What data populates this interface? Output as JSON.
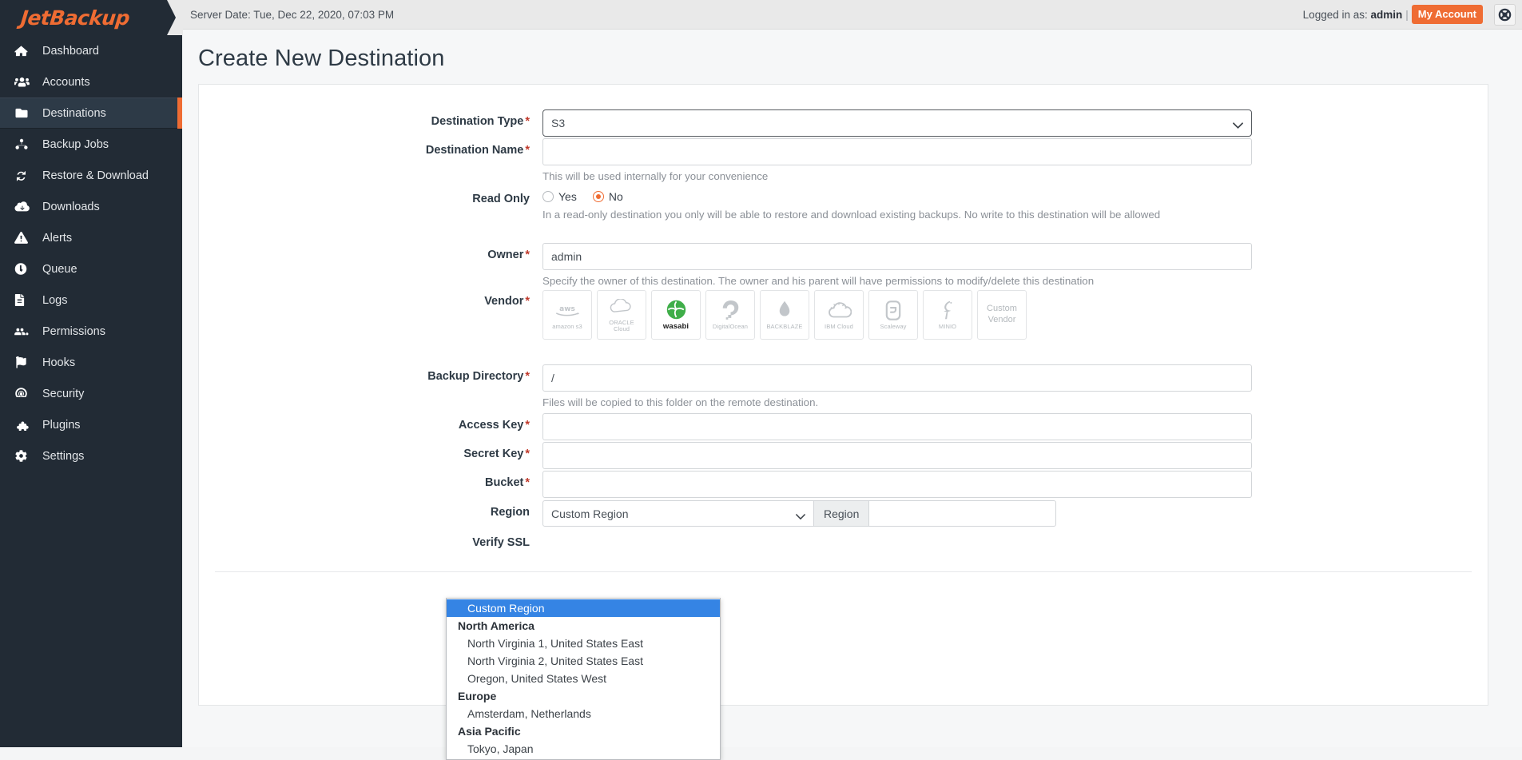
{
  "brand": {
    "name_main": "JetBack",
    "name_accent": "up",
    "full": "JetBackup"
  },
  "topbar": {
    "server_date": "Server Date: Tue, Dec 22, 2020, 07:03 PM",
    "logged_in_prefix": "Logged in as:",
    "logged_in_user": "admin",
    "separator": "|",
    "my_account_label": "My Account",
    "support_icon": "lifebuoy-icon"
  },
  "sidebar": {
    "items": [
      {
        "label": "Dashboard",
        "icon": "home-icon",
        "active": false
      },
      {
        "label": "Accounts",
        "icon": "users-icon",
        "active": false
      },
      {
        "label": "Destinations",
        "icon": "folder-icon",
        "active": true
      },
      {
        "label": "Backup Jobs",
        "icon": "sitemap-icon",
        "active": false
      },
      {
        "label": "Restore & Download",
        "icon": "sync-icon",
        "active": false
      },
      {
        "label": "Downloads",
        "icon": "cloud-download-icon",
        "active": false
      },
      {
        "label": "Alerts",
        "icon": "warning-icon",
        "active": false
      },
      {
        "label": "Queue",
        "icon": "clock-icon",
        "active": false
      },
      {
        "label": "Logs",
        "icon": "file-text-icon",
        "active": false
      },
      {
        "label": "Permissions",
        "icon": "users-cog-icon",
        "active": false
      },
      {
        "label": "Hooks",
        "icon": "flag-icon",
        "active": false
      },
      {
        "label": "Security",
        "icon": "fingerprint-icon",
        "active": false
      },
      {
        "label": "Plugins",
        "icon": "puzzle-icon",
        "active": false
      },
      {
        "label": "Settings",
        "icon": "gear-icon",
        "active": false
      }
    ]
  },
  "page": {
    "title": "Create New Destination"
  },
  "form": {
    "destination_type": {
      "label": "Destination Type",
      "required": "*",
      "value": "S3",
      "options": [
        "S3"
      ]
    },
    "destination_name": {
      "label": "Destination Name",
      "required": "*",
      "value": "",
      "placeholder": "",
      "help": "This will be used internally for your convenience"
    },
    "read_only": {
      "label": "Read Only",
      "options": [
        {
          "label": "Yes",
          "selected": false
        },
        {
          "label": "No",
          "selected": true
        }
      ],
      "help": "In a read-only destination you only will be able to restore and download existing backups. No write to this destination will be allowed"
    },
    "owner": {
      "label": "Owner",
      "required": "*",
      "value": "admin",
      "help": "Specify the owner of this destination. The owner and his parent will have permissions to modify/delete this destination"
    },
    "vendor": {
      "label": "Vendor",
      "required": "*",
      "items": [
        {
          "name": "amazon s3",
          "icon": "aws-icon",
          "selected": false
        },
        {
          "name": "Cloud",
          "icon": "oracle-cloud-icon",
          "sub": "ORACLE",
          "selected": false
        },
        {
          "name": "wasabi",
          "icon": "wasabi-icon",
          "selected": true
        },
        {
          "name": "DigitalOcean",
          "icon": "digitalocean-icon",
          "selected": false
        },
        {
          "name": "BACKBLAZE",
          "icon": "backblaze-icon",
          "selected": false
        },
        {
          "name": "IBM Cloud",
          "icon": "ibm-cloud-icon",
          "selected": false
        },
        {
          "name": "Scaleway",
          "icon": "scaleway-icon",
          "selected": false
        },
        {
          "name": "MINIO",
          "icon": "minio-icon",
          "selected": false
        },
        {
          "name": "Custom Vendor",
          "icon": "custom-vendor-icon",
          "selected": false
        }
      ]
    },
    "backup_directory": {
      "label": "Backup Directory",
      "required": "*",
      "value": "/",
      "help": "Files will be copied to this folder on the remote destination."
    },
    "access_key": {
      "label": "Access Key",
      "required": "*",
      "value": "",
      "placeholder": ""
    },
    "secret_key": {
      "label": "Secret Key",
      "required": "*",
      "value": "",
      "placeholder": ""
    },
    "bucket": {
      "label": "Bucket",
      "required": "*",
      "value": "",
      "placeholder": ""
    },
    "region": {
      "label": "Region",
      "selected_value": "Custom Region",
      "addon_label": "Region",
      "custom_value": "",
      "custom_placeholder": "",
      "dropdown_open": true,
      "dropdown": [
        {
          "type": "option",
          "label": "Custom Region",
          "selected": true
        },
        {
          "type": "optgroup",
          "label": "North America"
        },
        {
          "type": "option",
          "label": "North Virginia 1, United States East",
          "selected": false
        },
        {
          "type": "option",
          "label": "North Virginia 2, United States East",
          "selected": false
        },
        {
          "type": "option",
          "label": "Oregon, United States West",
          "selected": false
        },
        {
          "type": "optgroup",
          "label": "Europe"
        },
        {
          "type": "option",
          "label": "Amsterdam, Netherlands",
          "selected": false
        },
        {
          "type": "optgroup",
          "label": "Asia Pacific"
        },
        {
          "type": "option",
          "label": "Tokyo, Japan",
          "selected": false
        }
      ]
    },
    "verify_ssl": {
      "label": "Verify SSL"
    }
  },
  "colors": {
    "brand_orange": "#ef6c33",
    "sidebar_bg": "#222b35",
    "sidebar_active_bg": "#2d3a47",
    "dropdown_highlight": "#3584e4",
    "required_red": "#c0392b",
    "wasabi_green": "#3fae49"
  }
}
